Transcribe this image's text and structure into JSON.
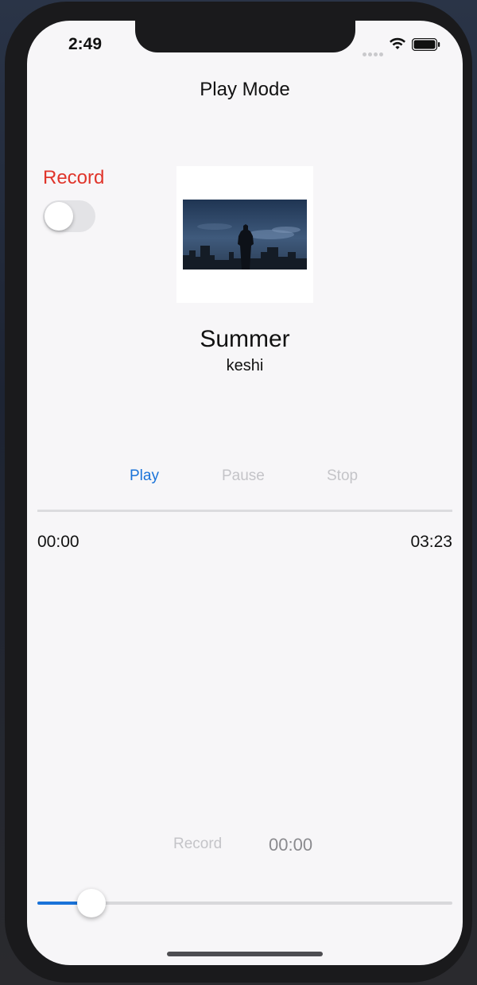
{
  "status_bar": {
    "time": "2:49",
    "icons": [
      "cellular-signal-icon",
      "wifi-icon",
      "battery-icon"
    ]
  },
  "nav": {
    "title": "Play Mode"
  },
  "record_toggle": {
    "label": "Record",
    "on": false,
    "label_color": "#e0352b"
  },
  "album_art": {
    "icon": "album-art-image"
  },
  "song": {
    "title": "Summer",
    "artist": "keshi"
  },
  "controls": {
    "play": "Play",
    "pause": "Pause",
    "stop": "Stop",
    "accent_color": "#1a73d9",
    "disabled_color": "#c4c4c8"
  },
  "playback": {
    "current_time": "00:00",
    "duration": "03:23"
  },
  "recording": {
    "label": "Record",
    "elapsed": "00:00"
  },
  "slider": {
    "progress": 0.13
  }
}
